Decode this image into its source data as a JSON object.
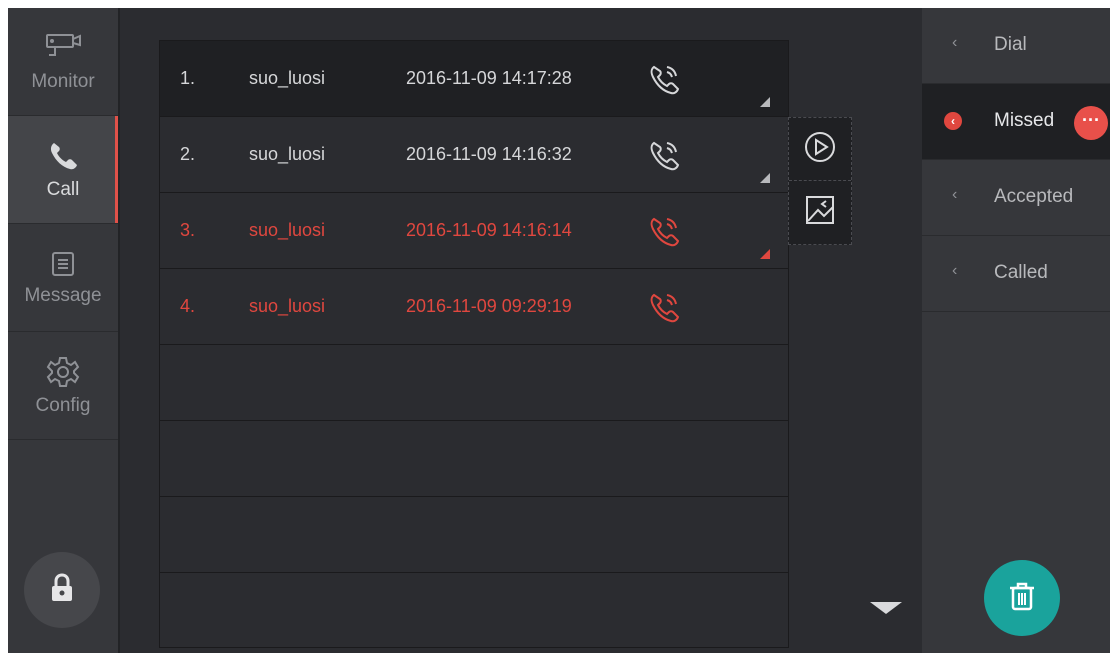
{
  "nav": {
    "items": [
      {
        "label": "Monitor",
        "icon": "camera-icon"
      },
      {
        "label": "Call",
        "icon": "phone-icon"
      },
      {
        "label": "Message",
        "icon": "message-icon"
      },
      {
        "label": "Config",
        "icon": "gear-icon"
      }
    ],
    "active": "Call",
    "lock_icon": "lock-icon"
  },
  "call_list": {
    "rows": [
      {
        "num": "1.",
        "name": "suo_luosi",
        "time": "2016-11-09 14:17:28",
        "status": "normal",
        "selected": true,
        "has_record": true
      },
      {
        "num": "2.",
        "name": "suo_luosi",
        "time": "2016-11-09 14:16:32",
        "status": "normal",
        "selected": false,
        "has_record": true
      },
      {
        "num": "3.",
        "name": "suo_luosi",
        "time": "2016-11-09 14:16:14",
        "status": "missed",
        "selected": false,
        "has_record": true
      },
      {
        "num": "4.",
        "name": "suo_luosi",
        "time": "2016-11-09 09:29:19",
        "status": "missed",
        "selected": false,
        "has_record": false
      }
    ],
    "empty_rows": 4
  },
  "side_actions": [
    "play-icon",
    "image-icon"
  ],
  "right_panel": {
    "tabs": [
      {
        "label": "Dial",
        "chevron": "‹"
      },
      {
        "label": "Missed",
        "chevron": "‹",
        "badge": "···"
      },
      {
        "label": "Accepted",
        "chevron": "‹"
      },
      {
        "label": "Called",
        "chevron": "‹"
      }
    ],
    "active": "Missed",
    "delete_icon": "trash-icon"
  },
  "colors": {
    "missed": "#e0473f",
    "accent_teal": "#1aa39c",
    "background": "#2b2c30"
  }
}
